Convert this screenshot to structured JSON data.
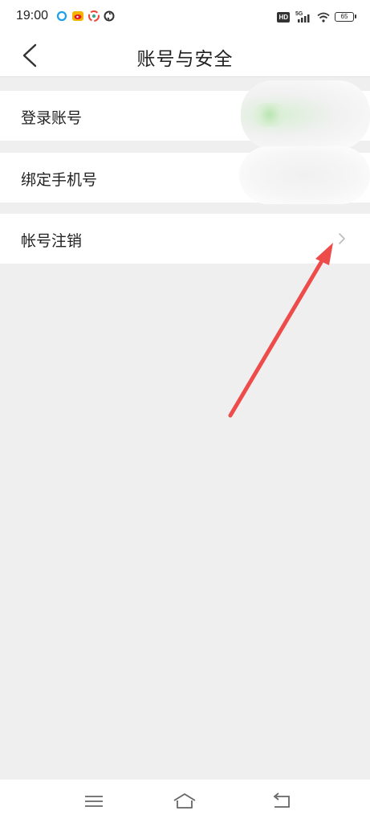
{
  "status_bar": {
    "time": "19:00",
    "network": "5G",
    "hd": "HD",
    "battery": "65",
    "left_icons": [
      "notification-app-icon",
      "weibo-icon",
      "app-icon",
      "sync-icon"
    ],
    "right_icons": [
      "hd-icon",
      "signal-5g-icon",
      "wifi-icon",
      "battery-icon"
    ]
  },
  "header": {
    "title": "账号与安全",
    "back_icon": "chevron-left-icon"
  },
  "settings": {
    "items": [
      {
        "label": "登录账号",
        "value_hidden": true
      },
      {
        "label": "绑定手机号",
        "value_hidden": true
      },
      {
        "label": "帐号注销",
        "icon": "chevron-right-icon"
      }
    ]
  },
  "annotation": {
    "color": "#ee4b4b"
  },
  "system_nav": {
    "icons": [
      "menu-icon",
      "home-icon",
      "back-icon"
    ]
  },
  "colors": {
    "background": "#efefef",
    "card": "#ffffff",
    "text": "#222222",
    "chevron": "#bbbbbb"
  }
}
